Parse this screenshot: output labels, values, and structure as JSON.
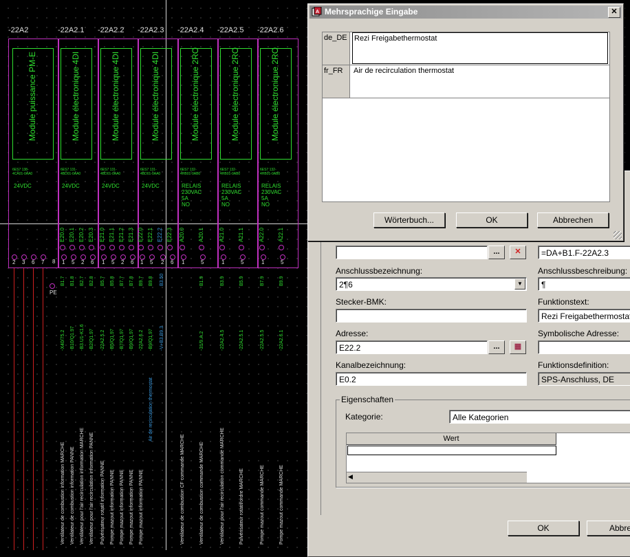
{
  "schematic": {
    "module_tags": [
      "-22A2",
      "-22A2.1",
      "-22A2.2",
      "-22A2.3",
      "-22A2.4",
      "-22A2.5",
      "-22A2.6"
    ],
    "module_titles": [
      "Module puissance PM-E",
      "Module électronique 4DI",
      "Module électronique 4DI",
      "Module électronique 4DI",
      "Module électronique 2RO",
      "Module électronique 2RO",
      "Module électronique 2RO"
    ],
    "module_parts": [
      "6ES7 138-\n4CA01-0AA0",
      "6ES7 131-\n4BD01-0AA0",
      "6ES7 131-\n4BD01-0AA0",
      "6ES7 131-\n4BD01-0AA0",
      "6ES7 132-\n4HB01-0AB0",
      "6ES7 132-\n4HB01-0AB0",
      "6ES7 132-\n4HB01-0AB0"
    ],
    "module_specs": [
      "24VDC",
      "24VDC",
      "24VDC",
      "24VDC",
      "RELAIS\n230VAC\n5A\nNO",
      "RELAIS\n230VAC\n5A\nNO",
      "RELAIS\n230VAC\n5A\nNO"
    ],
    "channels": [
      "E20.0",
      "E20.1",
      "E20.2",
      "E20.3",
      "E21.0",
      "E21.1",
      "E21.2",
      "E21.3",
      "E22.0",
      "E22.1",
      "E22.2",
      "E22.3",
      "A20.0",
      "A20.1",
      "A21.0",
      "A21.1",
      "A22.0",
      "A22.1"
    ],
    "pin_numbers": [
      "2",
      "3",
      "6",
      "7",
      "1",
      "5",
      "2",
      "6",
      "1",
      "5",
      "2",
      "6",
      "1",
      "5",
      "2",
      "6",
      "1",
      "5",
      "1",
      "5",
      "1",
      "5"
    ],
    "pe_label": "PE",
    "pin_8_label": "8",
    "terminal_codes": [
      "B1.7",
      "B1.8",
      "B2.7",
      "B2.8",
      "B5.7",
      "B5.8",
      "B7.7",
      "B7.8",
      "B9.7",
      "B9.8",
      "B3.50",
      "B1.9",
      "B3.9",
      "B5.9",
      "B7.9",
      "B9.9"
    ],
    "wire_codes": [
      "-X40/75.2",
      "-B10/Q1.97",
      "-B3.U1-K1.6",
      "-B2/Q1.97",
      "-22A2.5.2",
      "-B5/Q1.97",
      "-B7/Q1.97",
      "-B9/Q1.97",
      "-22A2.6.2",
      "-B9/Q1.97",
      "-V+B3.B9.3",
      "-31/9.A.2",
      "-22A2.4.5",
      "-22A2.5.1",
      "-22A2.5.5",
      "-22A2.6.1"
    ],
    "descriptions": [
      "Ventilateur de combustion information MARCHE",
      "Ventilateur de combustion information PANNE",
      "Ventilateur pour l'air recirculation information MARCHE",
      "Ventilateur pour l'air recirculation information PANNE",
      "Pulvérisateur rotatif information PANNE",
      "Pompe mazout information PANNE",
      "Pompe mazout information PANNE",
      "Pompe mazout information PANNE",
      "Pompe mazout information PANNE",
      "Air de recirculation thermostat",
      "Ventilateur de combustion CF commande MARCHE",
      "Ventilateur de combustion commande MARCHE",
      "Ventilateur pour l'air recirculation commande MARCHE",
      "Pulvérisateur rotatif/ordre MARCHE",
      "Pompe mazout commande MARCHE",
      "Pompe mazout commande MARCHE"
    ]
  },
  "multilang_dialog": {
    "title": "Mehrsprachige Eingabe",
    "close_glyph": "✕",
    "rows": [
      {
        "lang": "de_DE",
        "text": "Rezi Freigabethermostat"
      },
      {
        "lang": "fr_FR",
        "text": "Air de recirculation thermostat"
      }
    ],
    "buttons": {
      "dictionary": "Wörterbuch...",
      "ok": "OK",
      "cancel": "Abbrechen"
    }
  },
  "properties_dialog": {
    "dt_field": "=DA+B1.F-22A2.3",
    "browse_glyph": "...",
    "anschlussbezeichnung_label": "Anschlussbezeichnung:",
    "anschlussbezeichnung_value": "2¶6",
    "anschlussbeschreibung_label": "Anschlussbeschreibung:",
    "anschlussbeschreibung_value": "¶",
    "stecker_label": "Stecker-BMK:",
    "stecker_value": "",
    "funktionstext_label": "Funktionstext:",
    "funktionstext_value": "Rezi Freigabethermostat",
    "adresse_label": "Adresse:",
    "adresse_value": "E22.2",
    "symbolische_label": "Symbolische Adresse:",
    "symbolische_value": "",
    "kanal_label": "Kanalbezeichnung:",
    "kanal_value": "E0.2",
    "funktionsdef_label": "Funktionsdefinition:",
    "funktionsdef_value": "SPS-Anschluss, DE",
    "eigenschaften_label": "Eigenschaften",
    "kategorie_label": "Kategorie:",
    "kategorie_value": "Alle Kategorien",
    "grid_header_wert": "Wert",
    "ok": "OK",
    "cancel": "Abbrec"
  },
  "colors": {
    "green": "#30e030",
    "magenta": "#c030c0",
    "red": "#d02020",
    "selected": "#3a9ae0"
  }
}
